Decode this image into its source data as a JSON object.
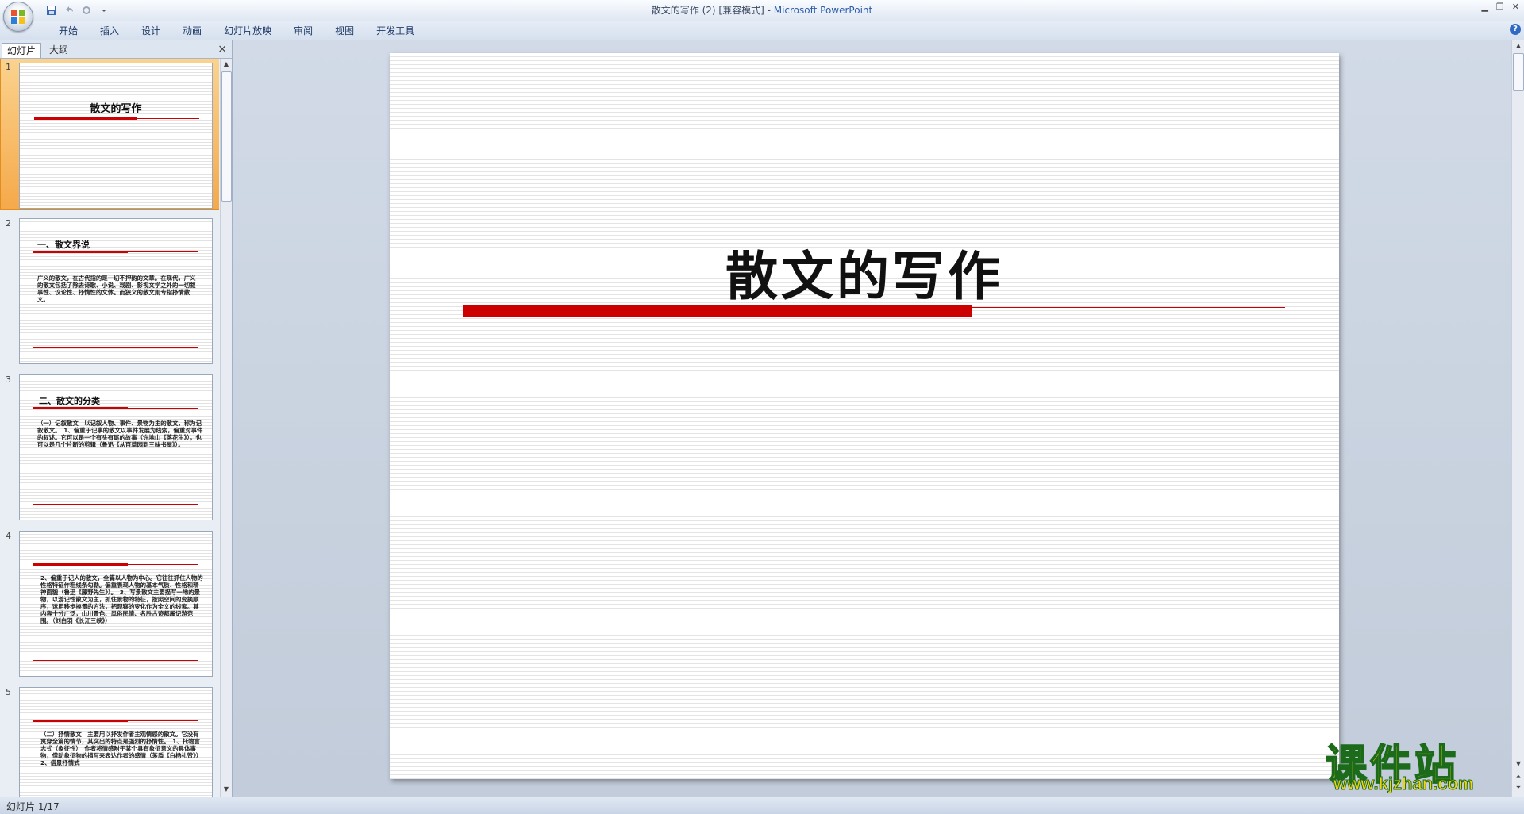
{
  "window": {
    "title_doc": "散文的写作 (2) [兼容模式] - ",
    "title_app": "Microsoft PowerPoint"
  },
  "qat": {
    "icons": [
      "save-icon",
      "undo-icon",
      "redo-icon",
      "customize-icon"
    ]
  },
  "ribbon": {
    "tabs": [
      "开始",
      "插入",
      "设计",
      "动画",
      "幻灯片放映",
      "审阅",
      "视图",
      "开发工具"
    ],
    "help": "?"
  },
  "left_pane": {
    "tabs": [
      "幻灯片",
      "大纲"
    ],
    "close": "×",
    "thumbnails": [
      {
        "num": "1",
        "title": "散文的写作",
        "body": ""
      },
      {
        "num": "2",
        "title": "一、散文界说",
        "body": "广义的散文，在古代指的是一切不押韵的文章。在现代，广义的散文包括了除去诗歌、小说、戏剧、影视文学之外的一切叙事性、议论性、抒情性的文体。而狭义的散文则专指抒情散文。"
      },
      {
        "num": "3",
        "title": "二、散文的分类",
        "body": "（一）记叙散文　以记叙人物、事件、景物为主的散文，称为记叙散文。　1、偏重于记事的散文以事件发展为线索，偏重对事件的叙述。它可以是一个有头有尾的故事（许地山《落花生》），也可以是几个片断的剪辑（鲁迅《从百草园到三味书屋》）。"
      },
      {
        "num": "4",
        "title": "",
        "body": "2、偏重于记人的散文，全篇以人物为中心。它往往抓住人物的性格特征作粗线条勾勒。偏重表现人物的基本气质、性格和精神面貌（鲁迅《藤野先生》）。　3、写景散文主要描写一地的景物，以游记性散文为主，抓住景物的特征，按照空间的变换顺序，运用移步换景的方法，把观察的变化作为全文的线索。其内容十分广泛，山川景色、风俗民情、名胜古迹都属记游范围。（刘白羽《长江三峡》）"
      },
      {
        "num": "5",
        "title": "",
        "body": "（二）抒情散文　主要用以抒发作者主观情感的散文。它没有贯穿全篇的情节，其突出的特点是强烈的抒情性。　1、托物言志式（象征性）　作者将情感附于某个具有象征意义的具体事物，借助象征物的描写来表达作者的感情（茅盾《白杨礼赞》）　2、借景抒情式"
      }
    ]
  },
  "slide": {
    "title": "散文的写作"
  },
  "status": {
    "text": "幻灯片 1/17"
  },
  "watermark": {
    "cn": "课件站",
    "url": "www.kjzhan.com"
  }
}
